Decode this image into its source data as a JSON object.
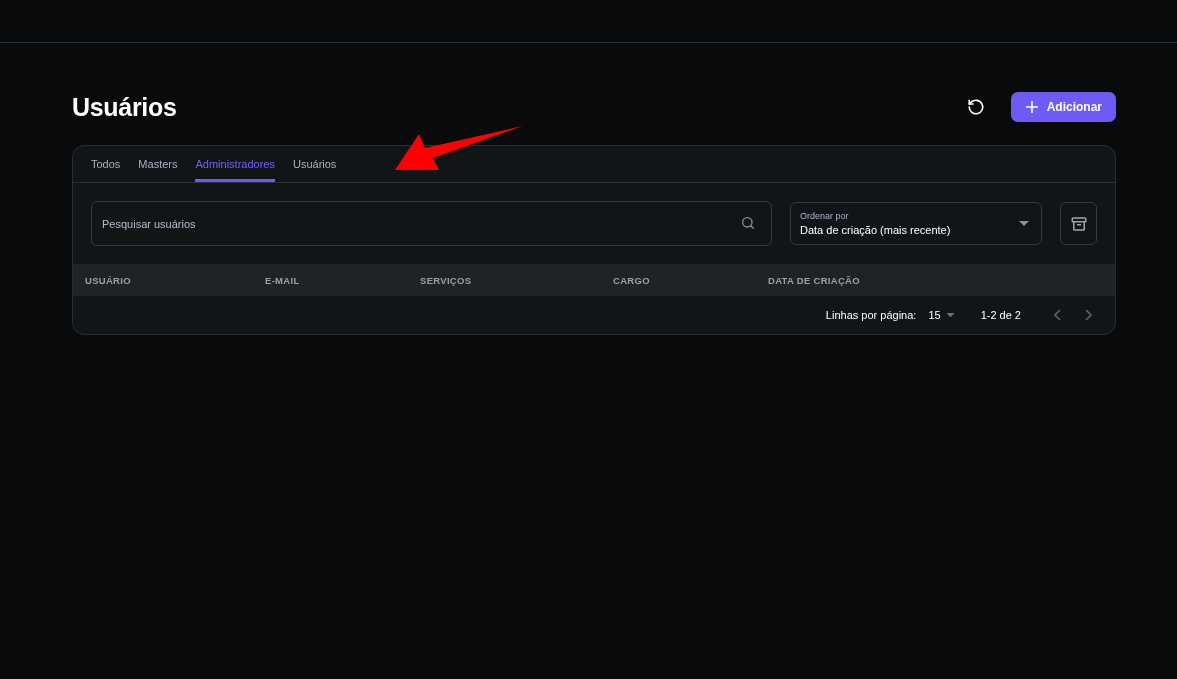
{
  "page": {
    "title": "Usuários"
  },
  "actions": {
    "add_button": "Adicionar"
  },
  "tabs": [
    {
      "label": "Todos",
      "selected": false
    },
    {
      "label": "Masters",
      "selected": false
    },
    {
      "label": "Administradores",
      "selected": true
    },
    {
      "label": "Usuários",
      "selected": false
    }
  ],
  "search": {
    "placeholder": "Pesquisar usuários"
  },
  "sort": {
    "label": "Ordenar por",
    "value": "Data de criação (mais recente)"
  },
  "table": {
    "columns": [
      "USUÁRIO",
      "E-MAIL",
      "SERVIÇOS",
      "CARGO",
      "DATA DE CRIAÇÃO"
    ]
  },
  "pagination": {
    "rows_label": "Linhas por página:",
    "rows_value": "15",
    "range": "1-2 de 2",
    "prev_disabled": true,
    "next_disabled": true
  }
}
